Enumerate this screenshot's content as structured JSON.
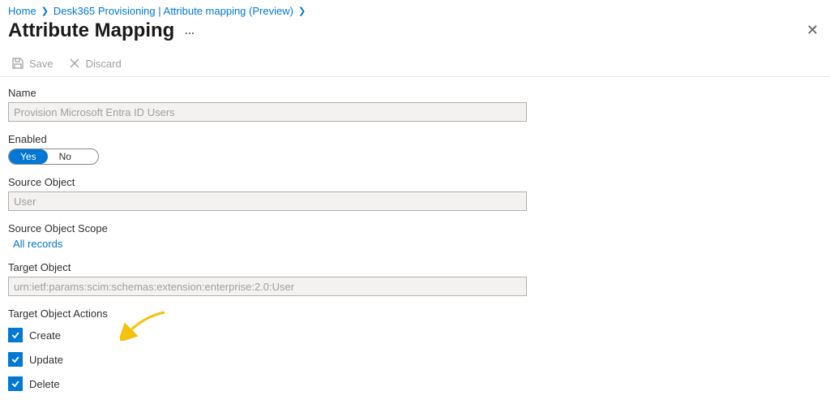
{
  "breadcrumb": {
    "items": [
      "Home",
      "Desk365 Provisioning | Attribute mapping (Preview)"
    ]
  },
  "page": {
    "title": "Attribute Mapping"
  },
  "toolbar": {
    "save_label": "Save",
    "discard_label": "Discard"
  },
  "form": {
    "name_label": "Name",
    "name_value": "Provision Microsoft Entra ID Users",
    "enabled_label": "Enabled",
    "enabled_yes": "Yes",
    "enabled_no": "No",
    "source_object_label": "Source Object",
    "source_object_value": "User",
    "source_scope_label": "Source Object Scope",
    "source_scope_value": "All records",
    "target_object_label": "Target Object",
    "target_object_value": "urn:ietf:params:scim:schemas:extension:enterprise:2.0:User",
    "target_actions_label": "Target Object Actions",
    "actions": {
      "create": "Create",
      "update": "Update",
      "delete": "Delete"
    }
  }
}
